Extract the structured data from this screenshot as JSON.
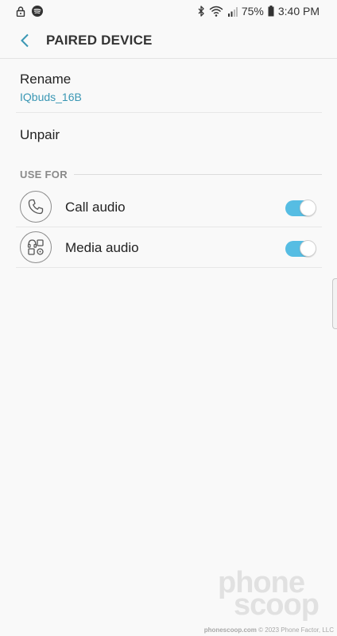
{
  "status_bar": {
    "left_icons": [
      "lock-icon",
      "spotify-icon"
    ],
    "right_icons": [
      "bluetooth-icon",
      "wifi-icon",
      "cell-signal-icon",
      "battery-icon"
    ],
    "battery": "75%",
    "time": "3:40 PM"
  },
  "app_bar": {
    "back_icon": "chevron-left-icon",
    "title": "PAIRED DEVICE"
  },
  "rename": {
    "label": "Rename",
    "value": "IQbuds_16B"
  },
  "unpair": {
    "label": "Unpair"
  },
  "use_for": {
    "header": "USE FOR",
    "items": [
      {
        "label": "Call audio",
        "icon": "phone-icon",
        "enabled": true
      },
      {
        "label": "Media audio",
        "icon": "media-audio-icon",
        "enabled": true
      }
    ]
  },
  "colors": {
    "accent": "#3a97b4",
    "switch_on": "#56bde3",
    "background": "#f9f9f9"
  },
  "watermark": {
    "logo_line1": "phone",
    "logo_line2": "scoop",
    "site": "phonescoop.com",
    "copyright": "© 2023 Phone Factor, LLC"
  }
}
